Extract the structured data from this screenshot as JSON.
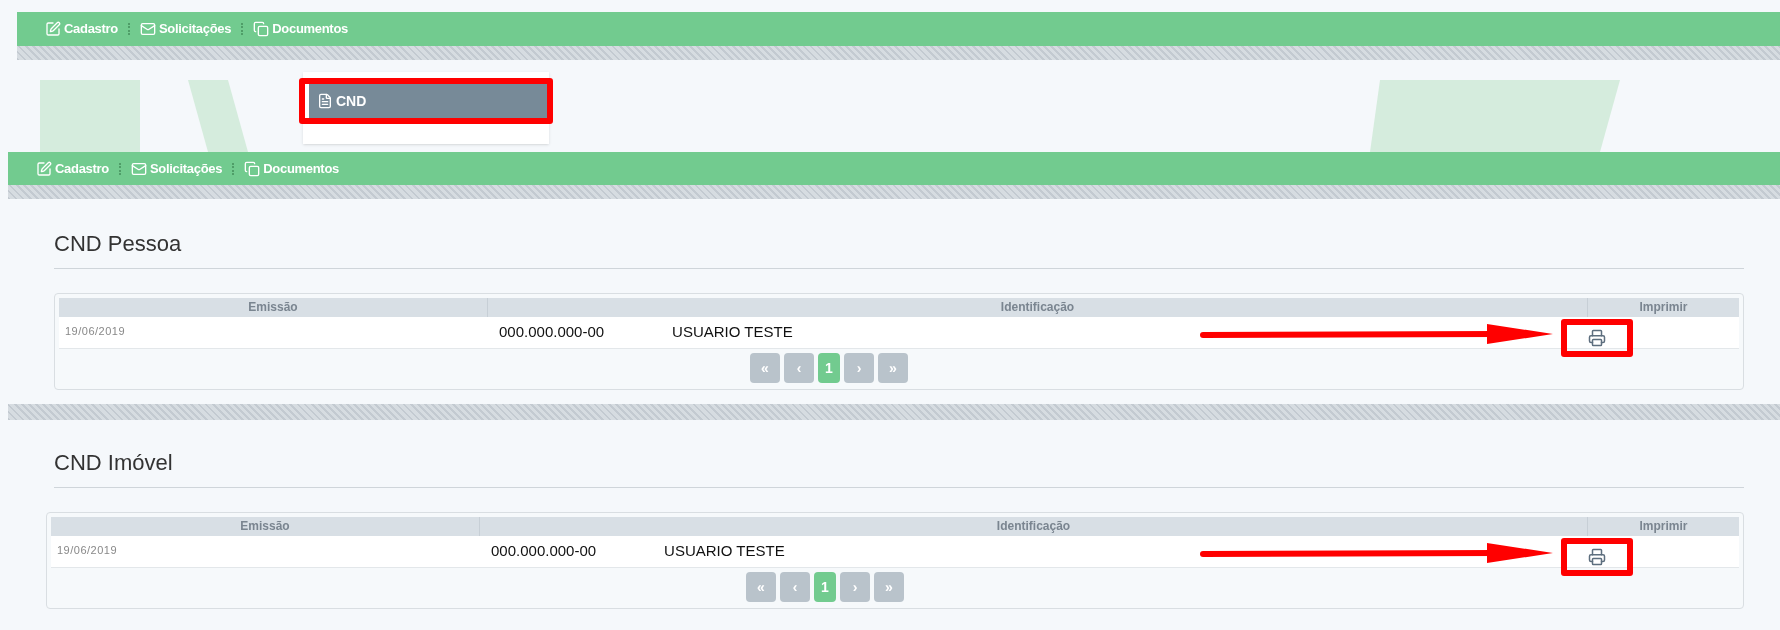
{
  "menu_bars": [
    {
      "items": [
        {
          "kind": "edit",
          "label": "Cadastro"
        },
        {
          "kind": "mail",
          "label": "Solicitações"
        },
        {
          "kind": "copy",
          "label": "Documentos"
        }
      ]
    },
    {
      "items": [
        {
          "kind": "edit",
          "label": "Cadastro"
        },
        {
          "kind": "mail",
          "label": "Solicitações"
        },
        {
          "kind": "copy",
          "label": "Documentos"
        }
      ]
    }
  ],
  "dropdown": {
    "items": [
      {
        "label": "CND",
        "selected": true
      }
    ]
  },
  "sections": [
    {
      "title": "CND Pessoa",
      "table": {
        "columns": [
          "Emissão",
          "Identificação",
          "Imprimir"
        ],
        "rows": [
          {
            "emission": "19/06/2019",
            "document": "000.000.000-00",
            "name": "USUARIO TESTE"
          }
        ]
      },
      "pagination": [
        {
          "label": "«",
          "selected": false
        },
        {
          "label": "‹",
          "selected": false
        },
        {
          "label": "1",
          "selected": true
        },
        {
          "label": "›",
          "selected": false
        },
        {
          "label": "»",
          "selected": false
        }
      ]
    },
    {
      "title": "CND Imóvel",
      "table": {
        "columns": [
          "Emissão",
          "Identificação",
          "Imprimir"
        ],
        "rows": [
          {
            "emission": "19/06/2019",
            "document": "000.000.000-00",
            "name": "USUARIO TESTE"
          }
        ]
      },
      "pagination": [
        {
          "label": "«",
          "selected": false
        },
        {
          "label": "‹",
          "selected": false
        },
        {
          "label": "1",
          "selected": true
        },
        {
          "label": "›",
          "selected": false
        },
        {
          "label": "»",
          "selected": false
        }
      ]
    }
  ]
}
